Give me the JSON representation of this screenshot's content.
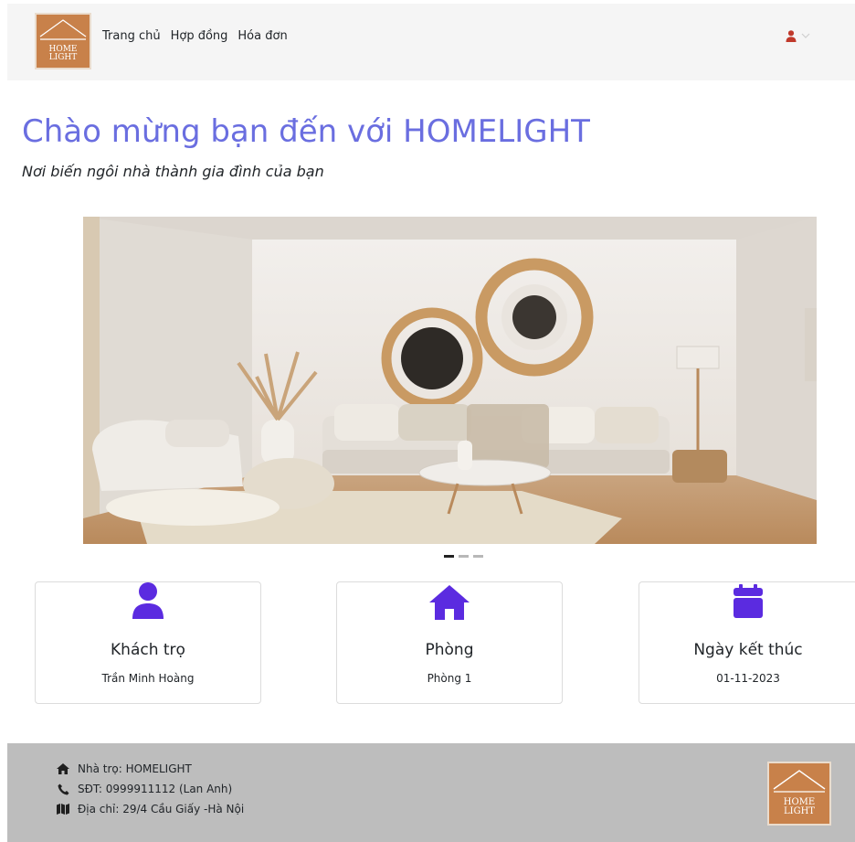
{
  "brand": {
    "logo_line1": "HOME",
    "logo_line2": "LIGHT",
    "color": "#c8814a"
  },
  "nav": {
    "items": [
      {
        "label": "Trang chủ"
      },
      {
        "label": "Hợp đồng"
      },
      {
        "label": "Hóa đơn"
      }
    ],
    "user_icon": "user-icon",
    "user_icon_color": "#c0392b"
  },
  "hero": {
    "title": "Chào mừng bạn đến với HOMELIGHT",
    "subtitle": "Nơi biến ngôi nhà thành gia đình của bạn",
    "title_color": "#6a6ee0"
  },
  "carousel": {
    "slide_count": 3,
    "active_index": 0
  },
  "cards": [
    {
      "icon": "user-icon",
      "title": "Khách trọ",
      "value": "Trần Minh Hoàng"
    },
    {
      "icon": "house-icon",
      "title": "Phòng",
      "value": "Phòng 1"
    },
    {
      "icon": "calendar-icon",
      "title": "Ngày kết thúc",
      "value": "01-11-2023"
    }
  ],
  "card_icon_color": "#5b2be0",
  "footer": {
    "name": "Nhà trọ: HOMELIGHT",
    "phone": "SĐT: 0999911112 (Lan Anh)",
    "address": "Địa chỉ: 29/4 Cầu Giấy -Hà Nội"
  }
}
